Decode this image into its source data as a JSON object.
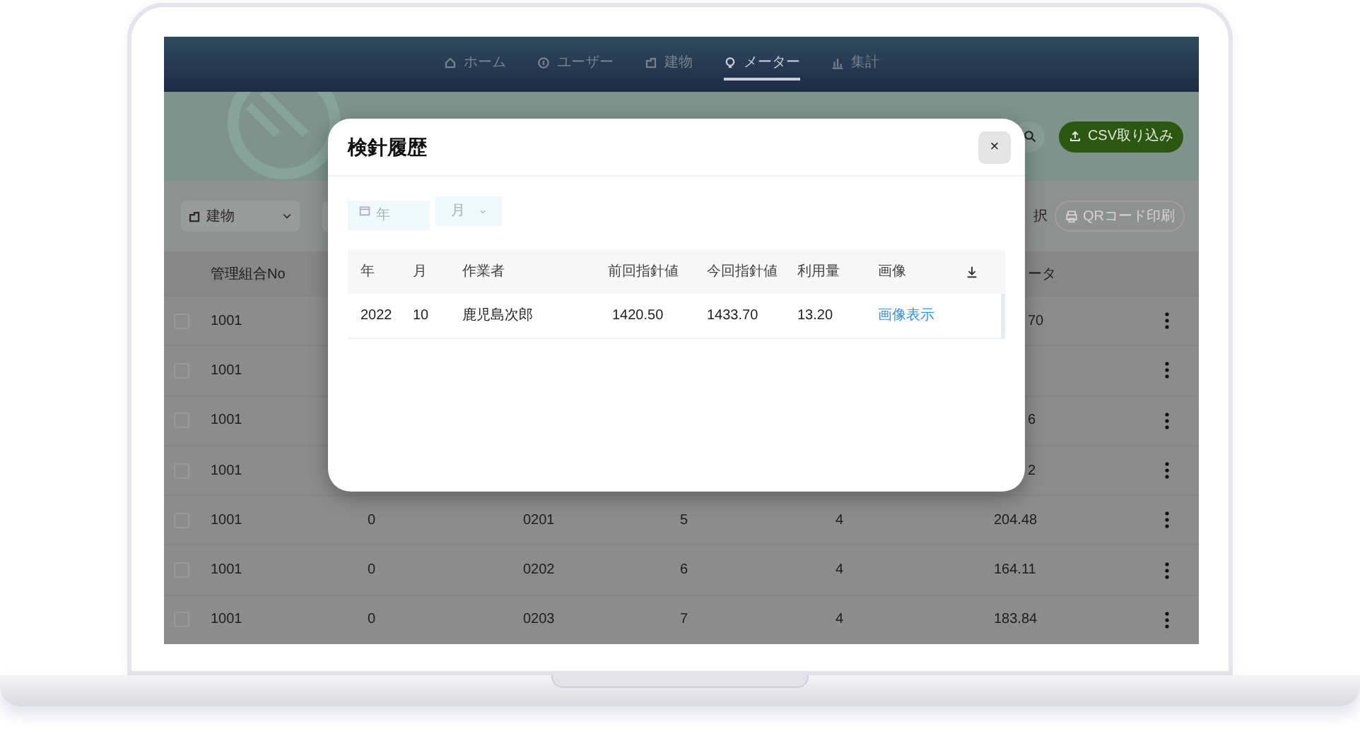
{
  "nav": {
    "items": [
      {
        "label": "ホーム",
        "selected": false
      },
      {
        "label": "ユーザー",
        "selected": false
      },
      {
        "label": "建物",
        "selected": false
      },
      {
        "label": "メーター",
        "selected": true
      },
      {
        "label": "集計",
        "selected": false
      }
    ]
  },
  "toolbar": {
    "import_button": "CSV取り込み"
  },
  "filters": {
    "building_select": "建物",
    "fragment": "択",
    "qr_button": {
      "label": "QRコード印刷",
      "disabled": true
    }
  },
  "table": {
    "columns": [
      "管理組合No",
      "ータ"
    ],
    "rows": [
      {
        "checked": false,
        "column_1": "1001",
        "column_6": "70"
      },
      {
        "checked": false,
        "column_1": "1001"
      },
      {
        "checked": false,
        "column_1": "1001",
        "column_6": "6"
      },
      {
        "checked": false,
        "column_1": "1001",
        "column_6": "2"
      },
      {
        "checked": false,
        "column_1": "1001",
        "column_2": "0",
        "column_3": "0201",
        "column_4": "5",
        "column_5": "4",
        "column_6": "204.48"
      },
      {
        "checked": false,
        "column_1": "1001",
        "column_2": "0",
        "column_3": "0202",
        "column_4": "6",
        "column_5": "4",
        "column_6": "164.11"
      },
      {
        "checked": false,
        "column_1": "1001",
        "column_2": "0",
        "column_3": "0203",
        "column_4": "7",
        "column_5": "4",
        "column_6": "183.84"
      }
    ]
  },
  "dialog": {
    "title": "検針履歴",
    "close": "×",
    "year_field": {
      "placeholder": "年"
    },
    "month_select": {
      "placeholder": "月"
    },
    "columns": [
      "年",
      "月",
      "作業者",
      "前回指針値",
      "今回指針値",
      "利用量",
      "画像"
    ],
    "rows": [
      {
        "year": "2022",
        "month": "10",
        "worker": "鹿児島次郎",
        "previous": "1420.50",
        "current": "1433.70",
        "usage": "13.20",
        "image_link": "画像表示"
      }
    ]
  }
}
